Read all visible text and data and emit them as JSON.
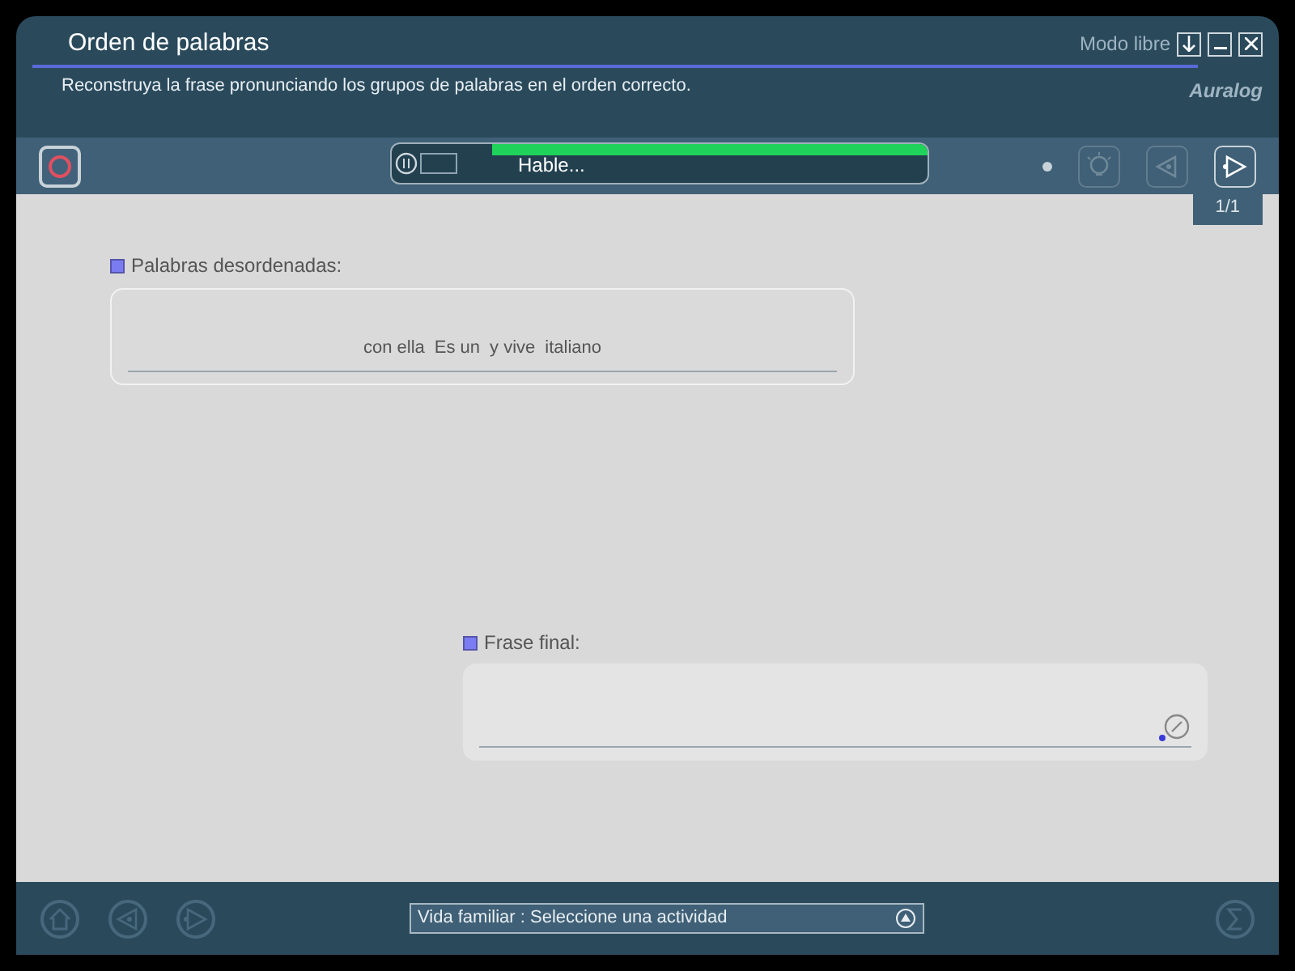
{
  "window": {
    "title": "Orden de palabras",
    "instruction": "Reconstruya la frase pronunciando los grupos de palabras en el orden correcto.",
    "mode": "Modo libre",
    "logo": "Auralog"
  },
  "toolbar": {
    "status": "Hable...",
    "level": 1,
    "counter": "1/1",
    "tools": [
      {
        "kind": "hint",
        "disabled": true
      },
      {
        "kind": "back",
        "disabled": true
      },
      {
        "kind": "next",
        "disabled": false
      }
    ]
  },
  "scrambled": {
    "label": "Palabras desordenadas:",
    "words": [
      "con ella",
      "Es un",
      "y vive",
      "italiano"
    ]
  },
  "final": {
    "label": "Frase final:"
  },
  "footer": {
    "nav": [
      {
        "kind": "home",
        "disabled": true
      },
      {
        "kind": "back",
        "disabled": true
      },
      {
        "kind": "next",
        "disabled": true
      }
    ],
    "activity": "Vida familiar : Seleccione una actividad"
  }
}
